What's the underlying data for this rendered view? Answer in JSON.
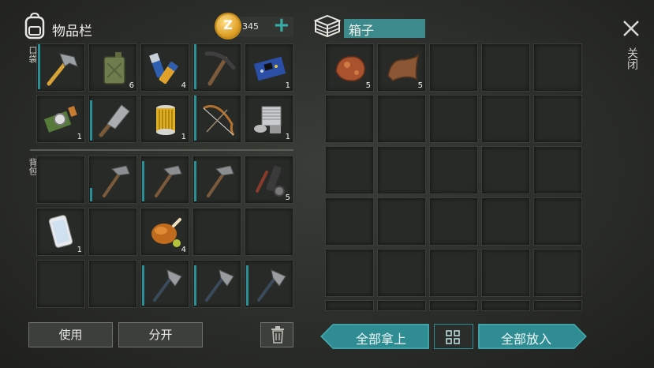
{
  "left_panel": {
    "title": "物品栏",
    "currency": "345",
    "add_symbol": "+",
    "pocket_label": "口袋",
    "backpack_label": "背包"
  },
  "pocket": [
    {
      "icon": "hammer-icon",
      "count": "",
      "dur": 1.0
    },
    {
      "icon": "jerrycan-icon",
      "count": "6",
      "dur": 0
    },
    {
      "icon": "batteries-icon",
      "count": "4",
      "dur": 0
    },
    {
      "icon": "pickaxe-icon",
      "count": "",
      "dur": 1.0
    },
    {
      "icon": "circuit-board-icon",
      "count": "1",
      "dur": 0
    },
    {
      "icon": "camera-module-icon",
      "count": "1",
      "dur": 0
    },
    {
      "icon": "cleaver-icon",
      "count": "",
      "dur": 0.9
    },
    {
      "icon": "oil-filter-icon",
      "count": "1",
      "dur": 0
    },
    {
      "icon": "bow-icon",
      "count": "",
      "dur": 1.0
    },
    {
      "icon": "engine-block-icon",
      "count": "1",
      "dur": 0
    }
  ],
  "backpack": [
    {
      "icon": "",
      "count": "",
      "dur": 0
    },
    {
      "icon": "stone-pickaxe-icon",
      "count": "",
      "dur": 0.3
    },
    {
      "icon": "stone-pickaxe-icon",
      "count": "",
      "dur": 0.9
    },
    {
      "icon": "stone-pickaxe-icon",
      "count": "",
      "dur": 0.9
    },
    {
      "icon": "tools-parts-icon",
      "count": "5",
      "dur": 0
    },
    {
      "icon": "smartphone-icon",
      "count": "1",
      "dur": 0
    },
    {
      "icon": "",
      "count": "",
      "dur": 0
    },
    {
      "icon": "roast-chicken-icon",
      "count": "4",
      "dur": 0
    },
    {
      "icon": "",
      "count": "",
      "dur": 0
    },
    {
      "icon": "",
      "count": "",
      "dur": 0
    },
    {
      "icon": "",
      "count": "",
      "dur": 0
    },
    {
      "icon": "",
      "count": "",
      "dur": 0
    },
    {
      "icon": "stone-hatchet-icon",
      "count": "",
      "dur": 0.9
    },
    {
      "icon": "stone-hatchet-icon",
      "count": "",
      "dur": 0.9
    },
    {
      "icon": "stone-hatchet-icon",
      "count": "",
      "dur": 0.9
    }
  ],
  "left_buttons": {
    "use": "使用",
    "split": "分开"
  },
  "right_panel": {
    "title": "箱子",
    "close_label": "关闭",
    "take_all": "全部拿上",
    "put_all": "全部放入"
  },
  "box": [
    {
      "icon": "copper-ore-icon",
      "count": "5"
    },
    {
      "icon": "leather-icon",
      "count": "5"
    }
  ],
  "colors": {
    "accent": "#2f8c93",
    "durability": "#2b8f95",
    "coin": "#e0a22a"
  }
}
